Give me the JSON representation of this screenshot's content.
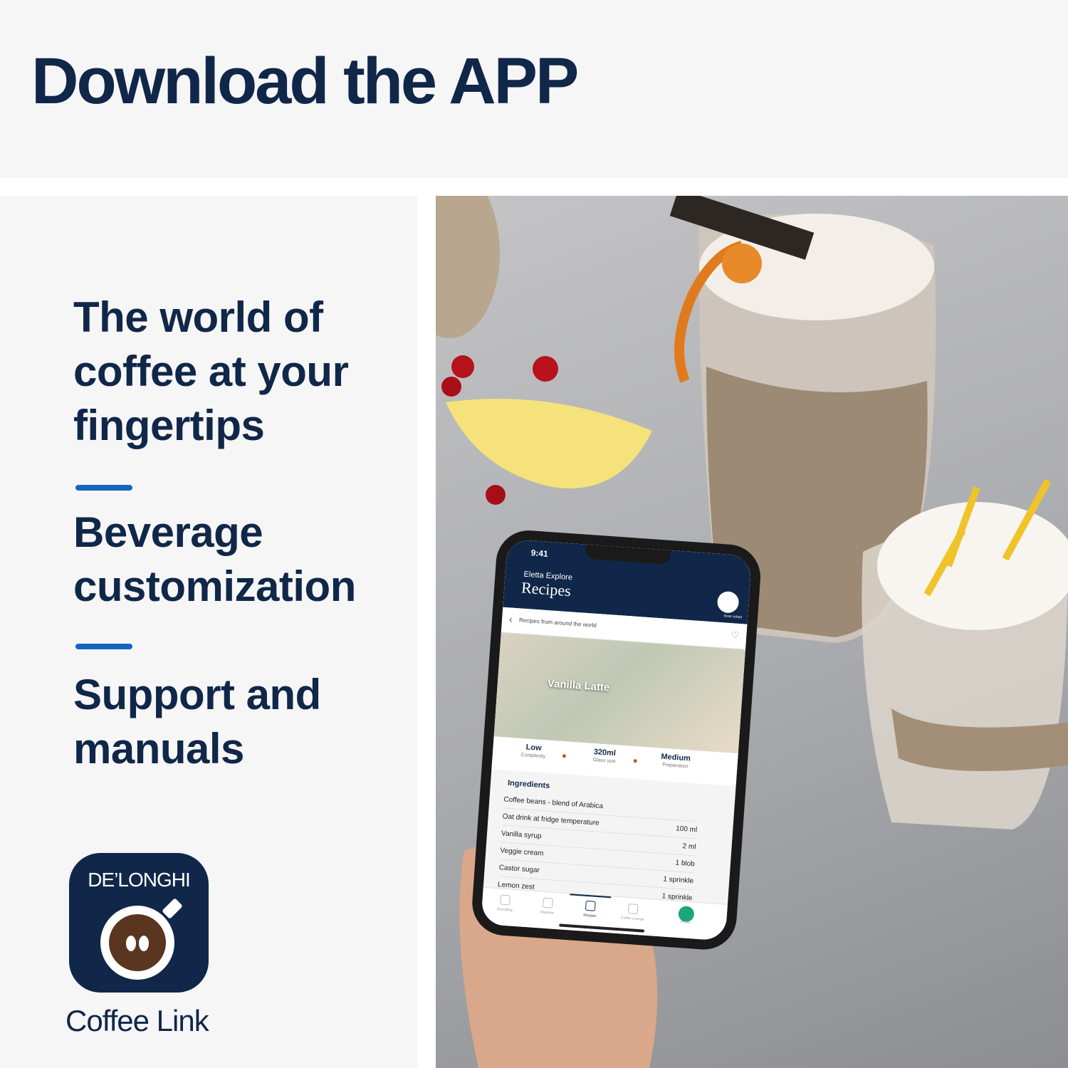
{
  "header": {
    "title": "Download the APP"
  },
  "features": {
    "f1": [
      "The world of",
      "coffee at your",
      "fingertips"
    ],
    "f2": [
      "Beverage",
      "customization"
    ],
    "f3": [
      "Support and",
      "manuals"
    ]
  },
  "app_badge": {
    "brand": "DE’LONGHI",
    "name": "Coffee Link"
  },
  "phone": {
    "status_time": "9:41",
    "header_subtitle": "Eletta Explore",
    "header_title": "Recipes",
    "bean_adapt_label": "Bean adapt",
    "breadcrumb": "Recipes from around the world",
    "recipe_title": "Vanilla Latte",
    "stats": [
      {
        "value": "Low",
        "label": "Complexity"
      },
      {
        "value": "320ml",
        "label": "Glass size"
      },
      {
        "value": "Medium",
        "label": "Preparation"
      }
    ],
    "ingredients_title": "Ingredients",
    "ingredients": [
      {
        "name": "Coffee beans - blend of Arabica",
        "qty": ""
      },
      {
        "name": "Oat drink at fridge temperature",
        "qty": "100 ml"
      },
      {
        "name": "Vanilla syrup",
        "qty": "2 ml"
      },
      {
        "name": "Veggie cream",
        "qty": "1 blob"
      },
      {
        "name": "Castor sugar",
        "qty": "1 sprinkle"
      },
      {
        "name": "Lemon zest",
        "qty": "1 sprinkle"
      }
    ],
    "tabs": [
      "Descaling",
      "Machine",
      "Recipes",
      "Coffee Lounge",
      "Profile"
    ]
  },
  "colors": {
    "navy": "#102749",
    "accent_blue": "#1565c0",
    "panel_bg": "#f6f6f6",
    "profile_green": "#1ba57a"
  }
}
